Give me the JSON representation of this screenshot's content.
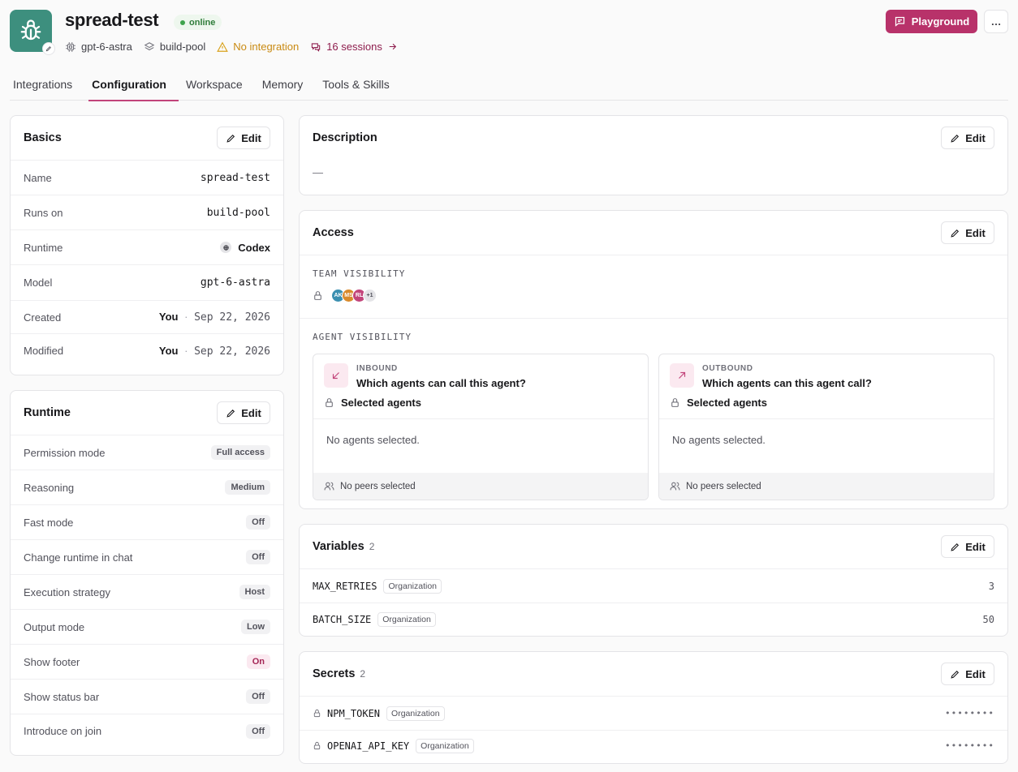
{
  "agent": {
    "name": "spread-test",
    "status": "online",
    "model": "gpt-6-astra",
    "pool": "build-pool",
    "integration_warning": "No integration",
    "sessions": "16 sessions"
  },
  "header": {
    "playground_label": "Playground",
    "more_label": "…"
  },
  "tabs": [
    {
      "label": "Integrations",
      "active": false
    },
    {
      "label": "Configuration",
      "active": true
    },
    {
      "label": "Workspace",
      "active": false
    },
    {
      "label": "Memory",
      "active": false
    },
    {
      "label": "Tools & Skills",
      "active": false
    }
  ],
  "edit_label": "Edit",
  "basics": {
    "title": "Basics",
    "rows": [
      {
        "label": "Name",
        "value": "spread-test"
      },
      {
        "label": "Runs on",
        "value": "build-pool"
      },
      {
        "label": "Runtime",
        "value": "Codex"
      },
      {
        "label": "Model",
        "value": "gpt-6-astra"
      },
      {
        "label": "Created",
        "who": "You",
        "sep": "·",
        "date": "Sep 22, 2026"
      },
      {
        "label": "Modified",
        "who": "You",
        "sep": "·",
        "date": "Sep 22, 2026"
      }
    ]
  },
  "runtime": {
    "title": "Runtime",
    "rows": [
      {
        "label": "Permission mode",
        "value": "Full access"
      },
      {
        "label": "Reasoning",
        "value": "Medium"
      },
      {
        "label": "Fast mode",
        "value": "Off"
      },
      {
        "label": "Change runtime in chat",
        "value": "Off"
      },
      {
        "label": "Execution strategy",
        "value": "Host"
      },
      {
        "label": "Output mode",
        "value": "Low"
      },
      {
        "label": "Show footer",
        "value": "On"
      },
      {
        "label": "Show status bar",
        "value": "Off"
      },
      {
        "label": "Introduce on join",
        "value": "Off"
      }
    ]
  },
  "description": {
    "title": "Description",
    "value": "—"
  },
  "access": {
    "title": "Access",
    "team_label": "TEAM VISIBILITY",
    "team_avatars": [
      {
        "initials": "AK",
        "color": "#3b8fb0"
      },
      {
        "initials": "MS",
        "color": "#d98a2b"
      },
      {
        "initials": "RL",
        "color": "#c2447a"
      }
    ],
    "team_more": "+1",
    "agent_label": "AGENT VISIBILITY",
    "inbound": {
      "kicker": "INBOUND",
      "question": "Which agents can call this agent?",
      "mode": "Selected agents",
      "empty": "No agents selected.",
      "footer": "No peers selected"
    },
    "outbound": {
      "kicker": "OUTBOUND",
      "question": "Which agents can this agent call?",
      "mode": "Selected agents",
      "empty": "No agents selected.",
      "footer": "No peers selected"
    }
  },
  "variables": {
    "title": "Variables",
    "count": "2",
    "items": [
      {
        "name": "MAX_RETRIES",
        "scope": "Organization",
        "value": "3"
      },
      {
        "name": "BATCH_SIZE",
        "scope": "Organization",
        "value": "50"
      }
    ]
  },
  "secrets": {
    "title": "Secrets",
    "count": "2",
    "items": [
      {
        "name": "NPM_TOKEN",
        "scope": "Organization",
        "value": "••••••••"
      },
      {
        "name": "OPENAI_API_KEY",
        "scope": "Organization",
        "value": "••••••••"
      }
    ]
  },
  "colors": {
    "accent": "#b8326a",
    "avatar_bg": "#3d8f7e",
    "online": "#3fa34d",
    "warning": "#c98a12"
  }
}
